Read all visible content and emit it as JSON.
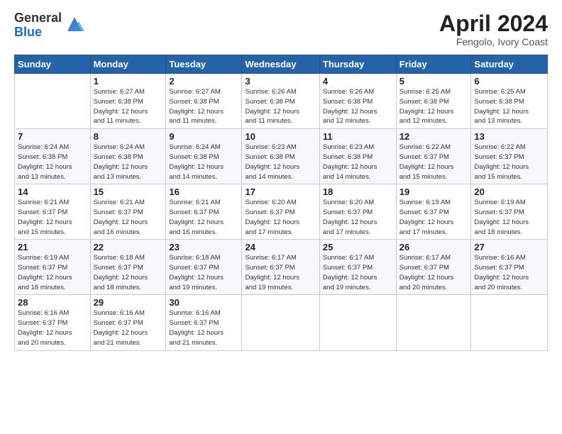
{
  "logo": {
    "general": "General",
    "blue": "Blue"
  },
  "title": "April 2024",
  "subtitle": "Fengolo, Ivory Coast",
  "days_header": [
    "Sunday",
    "Monday",
    "Tuesday",
    "Wednesday",
    "Thursday",
    "Friday",
    "Saturday"
  ],
  "weeks": [
    [
      {
        "num": "",
        "info": ""
      },
      {
        "num": "1",
        "info": "Sunrise: 6:27 AM\nSunset: 6:38 PM\nDaylight: 12 hours\nand 11 minutes."
      },
      {
        "num": "2",
        "info": "Sunrise: 6:27 AM\nSunset: 6:38 PM\nDaylight: 12 hours\nand 11 minutes."
      },
      {
        "num": "3",
        "info": "Sunrise: 6:26 AM\nSunset: 6:38 PM\nDaylight: 12 hours\nand 11 minutes."
      },
      {
        "num": "4",
        "info": "Sunrise: 6:26 AM\nSunset: 6:38 PM\nDaylight: 12 hours\nand 12 minutes."
      },
      {
        "num": "5",
        "info": "Sunrise: 6:25 AM\nSunset: 6:38 PM\nDaylight: 12 hours\nand 12 minutes."
      },
      {
        "num": "6",
        "info": "Sunrise: 6:25 AM\nSunset: 6:38 PM\nDaylight: 12 hours\nand 13 minutes."
      }
    ],
    [
      {
        "num": "7",
        "info": "Sunrise: 6:24 AM\nSunset: 6:38 PM\nDaylight: 12 hours\nand 13 minutes."
      },
      {
        "num": "8",
        "info": "Sunrise: 6:24 AM\nSunset: 6:38 PM\nDaylight: 12 hours\nand 13 minutes."
      },
      {
        "num": "9",
        "info": "Sunrise: 6:24 AM\nSunset: 6:38 PM\nDaylight: 12 hours\nand 14 minutes."
      },
      {
        "num": "10",
        "info": "Sunrise: 6:23 AM\nSunset: 6:38 PM\nDaylight: 12 hours\nand 14 minutes."
      },
      {
        "num": "11",
        "info": "Sunrise: 6:23 AM\nSunset: 6:38 PM\nDaylight: 12 hours\nand 14 minutes."
      },
      {
        "num": "12",
        "info": "Sunrise: 6:22 AM\nSunset: 6:37 PM\nDaylight: 12 hours\nand 15 minutes."
      },
      {
        "num": "13",
        "info": "Sunrise: 6:22 AM\nSunset: 6:37 PM\nDaylight: 12 hours\nand 15 minutes."
      }
    ],
    [
      {
        "num": "14",
        "info": "Sunrise: 6:21 AM\nSunset: 6:37 PM\nDaylight: 12 hours\nand 15 minutes."
      },
      {
        "num": "15",
        "info": "Sunrise: 6:21 AM\nSunset: 6:37 PM\nDaylight: 12 hours\nand 16 minutes."
      },
      {
        "num": "16",
        "info": "Sunrise: 6:21 AM\nSunset: 6:37 PM\nDaylight: 12 hours\nand 16 minutes."
      },
      {
        "num": "17",
        "info": "Sunrise: 6:20 AM\nSunset: 6:37 PM\nDaylight: 12 hours\nand 17 minutes."
      },
      {
        "num": "18",
        "info": "Sunrise: 6:20 AM\nSunset: 6:37 PM\nDaylight: 12 hours\nand 17 minutes."
      },
      {
        "num": "19",
        "info": "Sunrise: 6:19 AM\nSunset: 6:37 PM\nDaylight: 12 hours\nand 17 minutes."
      },
      {
        "num": "20",
        "info": "Sunrise: 6:19 AM\nSunset: 6:37 PM\nDaylight: 12 hours\nand 18 minutes."
      }
    ],
    [
      {
        "num": "21",
        "info": "Sunrise: 6:19 AM\nSunset: 6:37 PM\nDaylight: 12 hours\nand 18 minutes."
      },
      {
        "num": "22",
        "info": "Sunrise: 6:18 AM\nSunset: 6:37 PM\nDaylight: 12 hours\nand 18 minutes."
      },
      {
        "num": "23",
        "info": "Sunrise: 6:18 AM\nSunset: 6:37 PM\nDaylight: 12 hours\nand 19 minutes."
      },
      {
        "num": "24",
        "info": "Sunrise: 6:17 AM\nSunset: 6:37 PM\nDaylight: 12 hours\nand 19 minutes."
      },
      {
        "num": "25",
        "info": "Sunrise: 6:17 AM\nSunset: 6:37 PM\nDaylight: 12 hours\nand 19 minutes."
      },
      {
        "num": "26",
        "info": "Sunrise: 6:17 AM\nSunset: 6:37 PM\nDaylight: 12 hours\nand 20 minutes."
      },
      {
        "num": "27",
        "info": "Sunrise: 6:16 AM\nSunset: 6:37 PM\nDaylight: 12 hours\nand 20 minutes."
      }
    ],
    [
      {
        "num": "28",
        "info": "Sunrise: 6:16 AM\nSunset: 6:37 PM\nDaylight: 12 hours\nand 20 minutes."
      },
      {
        "num": "29",
        "info": "Sunrise: 6:16 AM\nSunset: 6:37 PM\nDaylight: 12 hours\nand 21 minutes."
      },
      {
        "num": "30",
        "info": "Sunrise: 6:16 AM\nSunset: 6:37 PM\nDaylight: 12 hours\nand 21 minutes."
      },
      {
        "num": "",
        "info": ""
      },
      {
        "num": "",
        "info": ""
      },
      {
        "num": "",
        "info": ""
      },
      {
        "num": "",
        "info": ""
      }
    ]
  ]
}
